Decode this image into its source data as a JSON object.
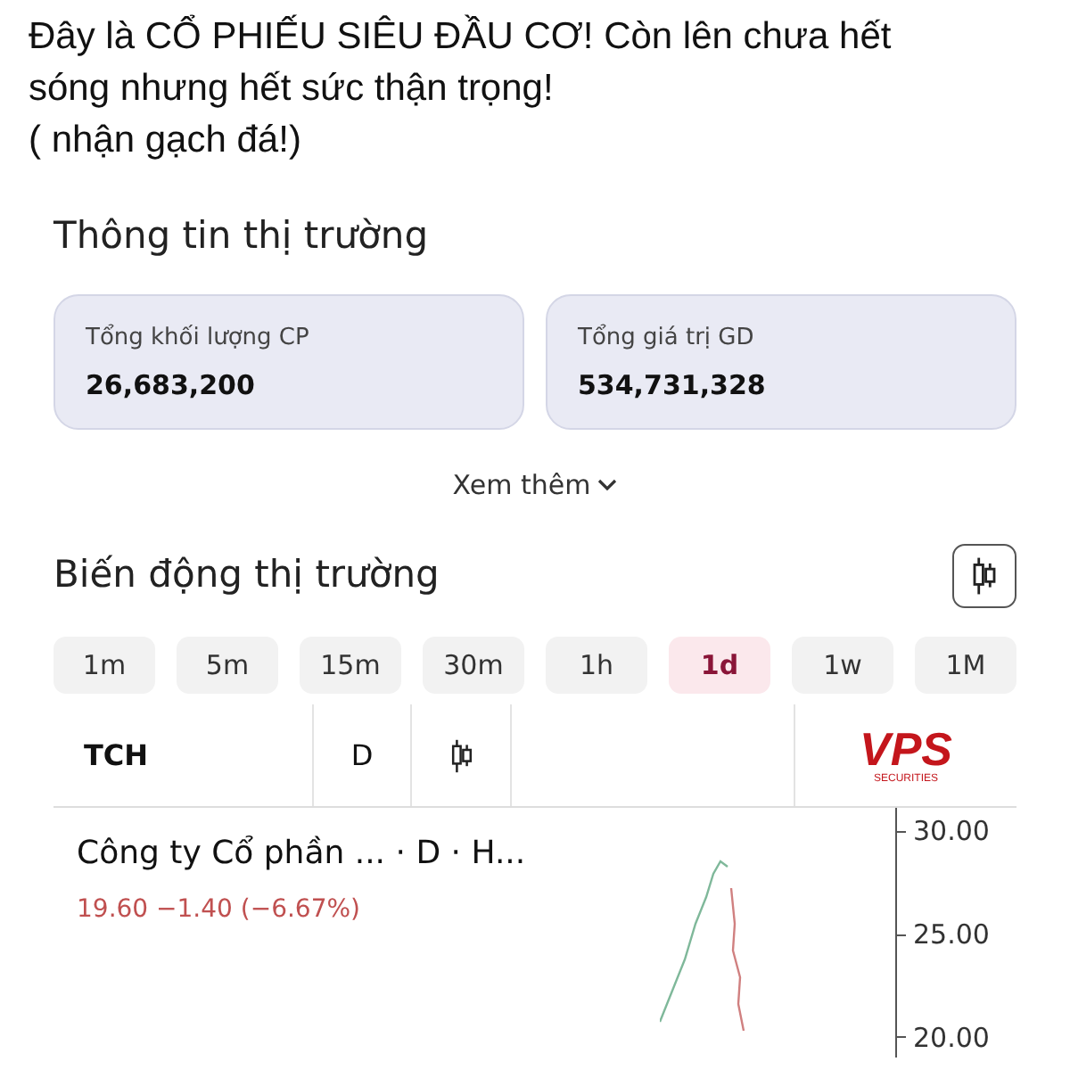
{
  "post": {
    "lines": [
      "Đây là CỔ PHIẾU SIÊU ĐẦU CƠ! Còn lên chưa hết sóng nhưng hết sức thận trọng!",
      "( nhận gạch đá!)"
    ]
  },
  "market_info": {
    "title": "Thông tin thị trường",
    "cards": [
      {
        "label": "Tổng khối lượng CP",
        "value": "26,683,200"
      },
      {
        "label": "Tổng giá trị GD",
        "value": "534,731,328"
      }
    ],
    "more": "Xem thêm"
  },
  "market_moves": {
    "title": "Biến động thị trường",
    "timeframes": [
      {
        "label": "1m",
        "selected": false
      },
      {
        "label": "5m",
        "selected": false
      },
      {
        "label": "15m",
        "selected": false
      },
      {
        "label": "30m",
        "selected": false
      },
      {
        "label": "1h",
        "selected": false
      },
      {
        "label": "1d",
        "selected": true
      },
      {
        "label": "1w",
        "selected": false
      },
      {
        "label": "1M",
        "selected": false
      }
    ]
  },
  "chart_toolbar": {
    "symbol": "TCH",
    "interval": "D",
    "logo": {
      "name": "VPS",
      "tagline": "SECURITIES"
    }
  },
  "chart": {
    "title": "Công ty Cổ phần ... · D · H...",
    "price": "19.60 −1.40 (−6.67%)",
    "y_labels": [
      "30.00",
      "25.00",
      "20.00"
    ]
  }
}
